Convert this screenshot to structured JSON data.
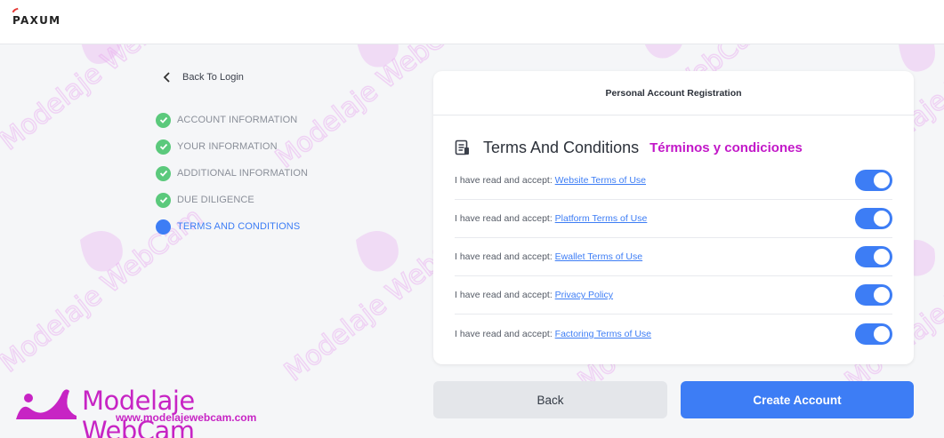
{
  "app": {
    "brand": "PAXUM"
  },
  "nav": {
    "back_to_login": "Back To Login"
  },
  "steps": [
    {
      "label": "ACCOUNT INFORMATION",
      "status": "done"
    },
    {
      "label": "YOUR INFORMATION",
      "status": "done"
    },
    {
      "label": "ADDITIONAL INFORMATION",
      "status": "done"
    },
    {
      "label": "DUE DILIGENCE",
      "status": "done"
    },
    {
      "label": "TERMS AND CONDITIONS",
      "status": "active"
    }
  ],
  "card": {
    "header": "Personal Account Registration",
    "title": "Terms And Conditions",
    "title_es": "Términos y condiciones",
    "rows": [
      {
        "prefix": "I have read and accept:",
        "link": "Website Terms of Use",
        "checked": true
      },
      {
        "prefix": "I have read and accept:",
        "link": "Platform Terms of Use",
        "checked": true
      },
      {
        "prefix": "I have read and accept:",
        "link": "Ewallet Terms of Use",
        "checked": true
      },
      {
        "prefix": "I have read and accept:",
        "link": "Privacy Policy",
        "checked": true
      },
      {
        "prefix": "I have read and accept:",
        "link": "Factoring Terms of Use",
        "checked": true
      }
    ]
  },
  "buttons": {
    "back": "Back",
    "create": "Create Account"
  },
  "watermark": {
    "title": "Modelaje WebCam",
    "url": "www.modelajewebcam.com"
  },
  "colors": {
    "accent": "#3d7df5",
    "done": "#5bc97c",
    "watermark": "#c724c4",
    "brand_red": "#e53935"
  }
}
